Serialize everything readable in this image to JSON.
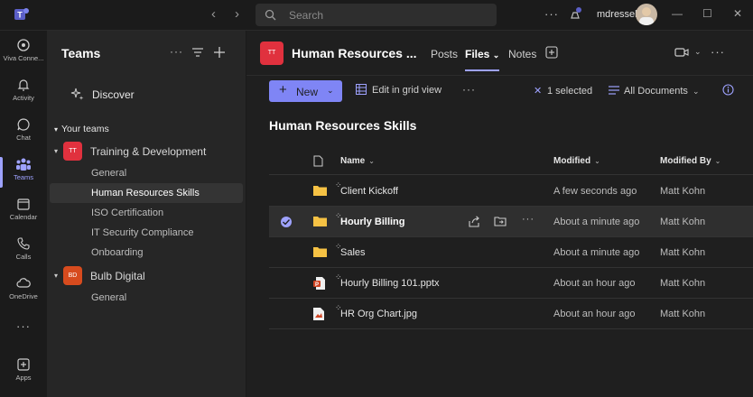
{
  "titlebar": {
    "search_placeholder": "Search",
    "user_name": "mdressel",
    "ellipsis": "···",
    "nav_back": "‹",
    "nav_forward": "›",
    "minimize": "—",
    "maximize": "☐",
    "close": "✕"
  },
  "rail": {
    "items": [
      {
        "label": "Viva Conne..."
      },
      {
        "label": "Activity"
      },
      {
        "label": "Chat"
      },
      {
        "label": "Teams"
      },
      {
        "label": "Calendar"
      },
      {
        "label": "Calls"
      },
      {
        "label": "OneDrive"
      },
      {
        "label": "Apps"
      }
    ],
    "more": "···"
  },
  "teams_panel": {
    "title": "Teams",
    "discover": "Discover",
    "section": "Your teams",
    "teams": [
      {
        "avatar": "TT",
        "name": "Training & Development",
        "color": "#e0313e",
        "channels": [
          "General",
          "Human Resources Skills",
          "ISO Certification",
          "IT Security Compliance",
          "Onboarding"
        ]
      },
      {
        "avatar": "BD",
        "name": "Bulb Digital",
        "color": "#d74b1e",
        "channels": [
          "General"
        ]
      }
    ]
  },
  "channel_header": {
    "avatar": "TT",
    "title": "Human Resources ...",
    "tabs": [
      "Posts",
      "Files",
      "Notes"
    ],
    "active_tab": "Files"
  },
  "command_bar": {
    "new_label": "New",
    "grid_label": "Edit in grid view",
    "selection": "1 selected",
    "view": "All Documents"
  },
  "library": {
    "title": "Human Resources Skills",
    "columns": {
      "name": "Name",
      "modified": "Modified",
      "modified_by": "Modified By"
    },
    "files": [
      {
        "name": "Client Kickoff",
        "modified": "A few seconds ago",
        "modified_by": "Matt Kohn",
        "type": "folder"
      },
      {
        "name": "Hourly Billing",
        "modified": "About a minute ago",
        "modified_by": "Matt Kohn",
        "type": "folder",
        "selected": true
      },
      {
        "name": "Sales",
        "modified": "About a minute ago",
        "modified_by": "Matt Kohn",
        "type": "folder"
      },
      {
        "name": "Hourly Billing 101.pptx",
        "modified": "About an hour ago",
        "modified_by": "Matt Kohn",
        "type": "pptx"
      },
      {
        "name": "HR Org Chart.jpg",
        "modified": "About an hour ago",
        "modified_by": "Matt Kohn",
        "type": "image"
      }
    ]
  },
  "colors": {
    "accent": "#9ea2ff",
    "button": "#7f85f5",
    "folder": "#f6c244",
    "ppt": "#d04423"
  }
}
